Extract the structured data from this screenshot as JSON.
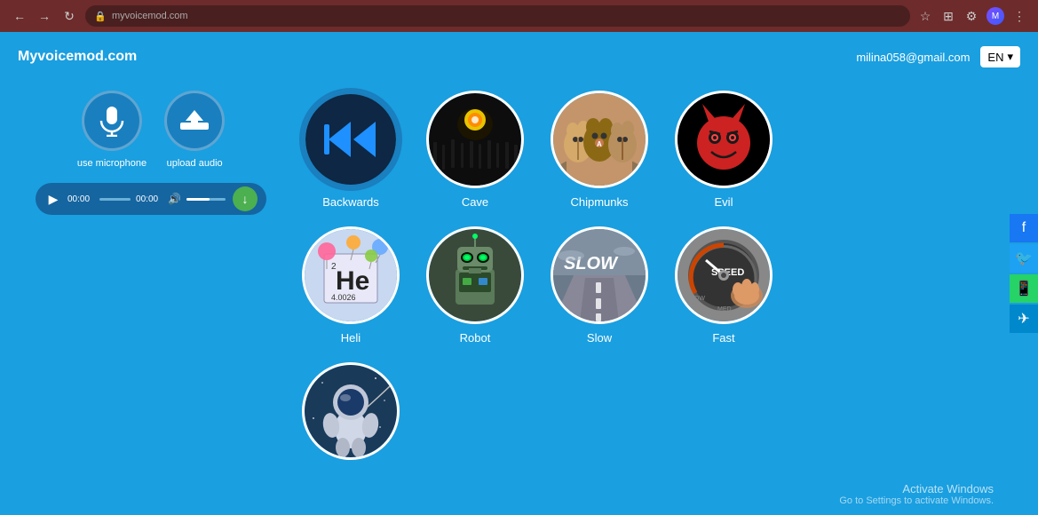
{
  "browser": {
    "url": "myvoicemod.com",
    "nav_back": "←",
    "nav_forward": "→",
    "reload": "↻"
  },
  "header": {
    "logo": "Myvoicemod.com",
    "user_email": "milina058@gmail.com",
    "lang": "EN"
  },
  "left_panel": {
    "mic_label": "use microphone",
    "upload_label": "upload audio",
    "time_current": "00:00",
    "time_total": "00:00"
  },
  "voices": {
    "row1": [
      {
        "id": "backwards",
        "label": "Backwards",
        "selected": true
      },
      {
        "id": "cave",
        "label": "Cave",
        "selected": false
      },
      {
        "id": "chipmunks",
        "label": "Chipmunks",
        "selected": false
      },
      {
        "id": "evil",
        "label": "Evil",
        "selected": false
      }
    ],
    "row2": [
      {
        "id": "heli",
        "label": "Heli",
        "selected": false
      },
      {
        "id": "robot",
        "label": "Robot",
        "selected": false
      },
      {
        "id": "slow",
        "label": "Slow",
        "selected": false
      },
      {
        "id": "fast",
        "label": "Fast",
        "selected": false
      }
    ],
    "row3": [
      {
        "id": "astronaut",
        "label": "",
        "selected": false
      }
    ]
  },
  "social": {
    "facebook": "f",
    "twitter": "t",
    "whatsapp": "w",
    "telegram": "✈"
  },
  "windows": {
    "activate_title": "Activate Windows",
    "activate_sub": "Go to Settings to activate Windows."
  }
}
